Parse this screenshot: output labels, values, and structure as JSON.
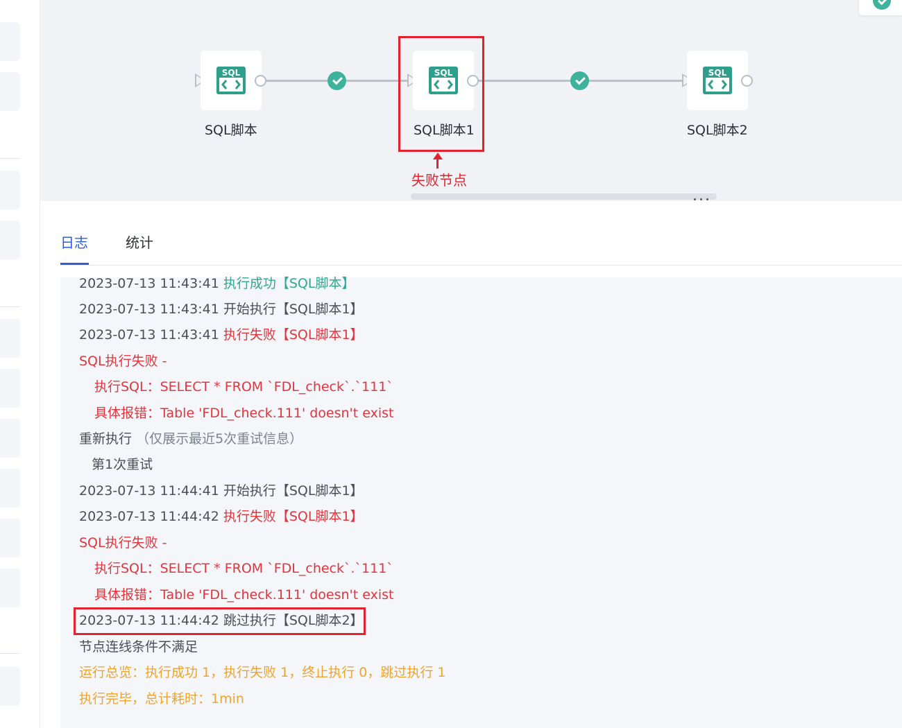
{
  "flow": {
    "nodes": [
      {
        "label": "SQL脚本",
        "icon": "sql-script-icon"
      },
      {
        "label": "SQL脚本1",
        "icon": "sql-script-icon"
      },
      {
        "label": "SQL脚本2",
        "icon": "sql-script-icon"
      }
    ],
    "edge_status": [
      "success",
      "success"
    ],
    "failed_node_annotation": "失败节点",
    "icon_text": "SQL"
  },
  "tabs": [
    {
      "label": "日志",
      "active": true
    },
    {
      "label": "统计",
      "active": false
    }
  ],
  "log": {
    "lines": [
      {
        "time": "2023-07-13 11:43:41",
        "text": "执行成功【SQL脚本】",
        "status": "success"
      },
      {
        "time": "2023-07-13 11:43:41",
        "text": "开始执行【SQL脚本1】",
        "status": "normal"
      },
      {
        "time": "2023-07-13 11:43:41",
        "text": "执行失败【SQL脚本1】",
        "status": "error"
      },
      {
        "text": "SQL执行失败 -",
        "status": "error"
      },
      {
        "text": "执行SQL：SELECT * FROM `FDL_check`.`111`",
        "status": "error",
        "indent": true
      },
      {
        "text": "具体报错：Table 'FDL_check.111' doesn't exist",
        "status": "error",
        "indent": true
      },
      {
        "text": "重新执行",
        "note": "（仅展示最近5次重试信息）",
        "status": "normal"
      },
      {
        "text": "第1次重试",
        "status": "normal",
        "indent_small": true
      },
      {
        "time": "2023-07-13 11:44:41",
        "text": "开始执行【SQL脚本1】",
        "status": "normal"
      },
      {
        "time": "2023-07-13 11:44:42",
        "text": "执行失败【SQL脚本1】",
        "status": "error"
      },
      {
        "text": "SQL执行失败 -",
        "status": "error"
      },
      {
        "text": "执行SQL：SELECT * FROM `FDL_check`.`111`",
        "status": "error",
        "indent": true
      },
      {
        "text": "具体报错：Table 'FDL_check.111' doesn't exist",
        "status": "error",
        "indent": true
      },
      {
        "time": "2023-07-13 11:44:42",
        "text": "跳过执行【SQL脚本2】",
        "status": "normal",
        "highlighted": true
      },
      {
        "text": "节点连线条件不满足",
        "status": "normal"
      },
      {
        "text": "运行总览：执行成功 1，执行失败 1，终止执行 0，跳过执行 1",
        "status": "summary"
      },
      {
        "text": "执行完毕，总计耗时：1min",
        "status": "summary"
      }
    ]
  },
  "colors": {
    "accent": "#2b5fd9",
    "success": "#3db39e",
    "error": "#e0353c",
    "summary": "#f0a32a",
    "annotation": "#e0232e"
  }
}
